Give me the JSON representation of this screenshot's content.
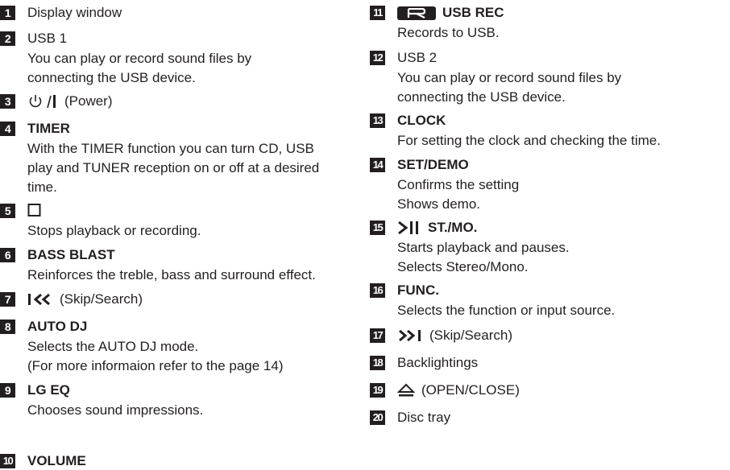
{
  "left": {
    "items": [
      {
        "num": "1",
        "title": "Display window"
      },
      {
        "num": "2",
        "title": "USB 1",
        "desc": [
          "You can play or record sound files by",
          "connecting the USB device."
        ]
      },
      {
        "num": "3",
        "title": "(Power)",
        "icon": "power-icon"
      },
      {
        "num": "4",
        "title": "TIMER",
        "desc": [
          "With the TIMER function you can turn CD, USB",
          "play and TUNER reception on or off at a desired",
          "time."
        ]
      },
      {
        "num": "5",
        "title": "",
        "icon": "stop-icon",
        "desc": [
          "Stops playback or recording."
        ]
      },
      {
        "num": "6",
        "title": "BASS BLAST",
        "desc": [
          "Reinforces the treble, bass and surround effect."
        ]
      },
      {
        "num": "7",
        "title": "(Skip/Search)",
        "icon": "skip-back-icon"
      },
      {
        "num": "8",
        "title": "AUTO DJ",
        "desc": [
          "Selects the AUTO DJ mode.",
          "(For more informaion refer to the page 14)"
        ]
      },
      {
        "num": "9",
        "title": "LG EQ",
        "desc": [
          "Chooses sound impressions."
        ]
      },
      {
        "num": "10",
        "title": "VOLUME"
      }
    ]
  },
  "right": {
    "items": [
      {
        "num": "11",
        "title": "USB REC",
        "icon": "rec-r-icon",
        "desc": [
          "Records to USB."
        ]
      },
      {
        "num": "12",
        "title": "USB 2",
        "desc": [
          "You can play or record sound files by",
          "connecting the USB device."
        ]
      },
      {
        "num": "13",
        "title": "CLOCK",
        "desc": [
          "For setting the clock and checking the time."
        ]
      },
      {
        "num": "14",
        "title": "SET/DEMO",
        "desc": [
          "Confirms the setting",
          "Shows demo."
        ]
      },
      {
        "num": "15",
        "title": "ST./MO.",
        "icon": "play-pause-icon",
        "desc": [
          "Starts playback and pauses.",
          "Selects Stereo/Mono."
        ]
      },
      {
        "num": "16",
        "title": "FUNC.",
        "desc": [
          "Selects the function or input source."
        ]
      },
      {
        "num": "17",
        "title": "(Skip/Search)",
        "icon": "skip-forward-icon"
      },
      {
        "num": "18",
        "title": "Backlightings"
      },
      {
        "num": "19",
        "title": "(OPEN/CLOSE)",
        "icon": "eject-icon"
      },
      {
        "num": "20",
        "title": "Disc tray"
      }
    ]
  }
}
